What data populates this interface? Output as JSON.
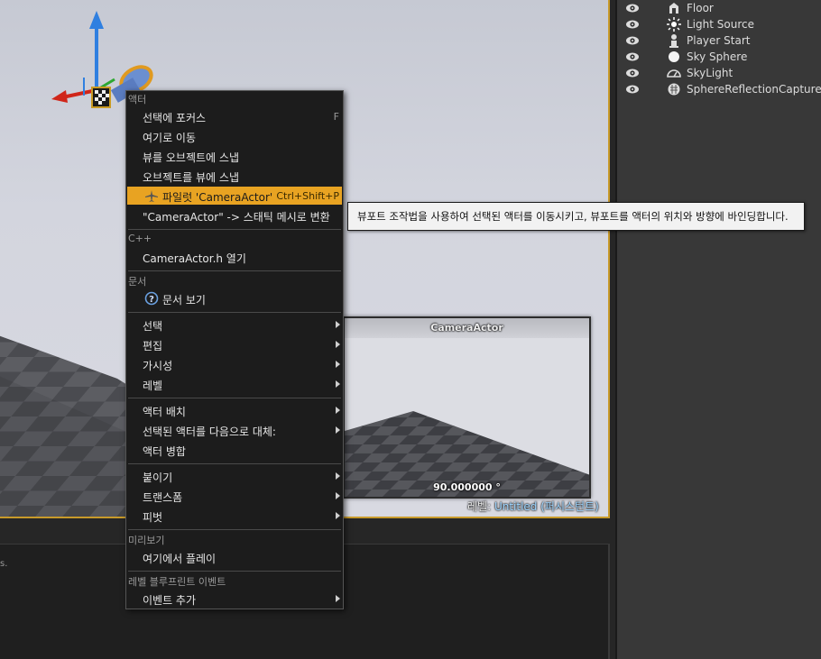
{
  "outliner": {
    "items": [
      {
        "label": "Floor",
        "icon": "floor-icon"
      },
      {
        "label": "Light Source",
        "icon": "light-source-icon"
      },
      {
        "label": "Player Start",
        "icon": "player-start-icon"
      },
      {
        "label": "Sky Sphere",
        "icon": "sky-sphere-icon"
      },
      {
        "label": "SkyLight",
        "icon": "skylight-icon"
      },
      {
        "label": "SphereReflectionCapture",
        "icon": "reflection-capture-icon"
      }
    ]
  },
  "viewport": {
    "preview_title": "CameraActor",
    "preview_angle": "90.000000 °",
    "level_prefix": "레벨: ",
    "level_name": "Untitled (퍼시스턴트)"
  },
  "bottom": {
    "text": "s."
  },
  "menu": {
    "sections": {
      "actor": "액터",
      "cpp": "C++",
      "docs": "문서",
      "preview": "미리보기",
      "level_bp": "레벨 블루프린트 이벤트"
    },
    "items": {
      "focus": "선택에 포커스",
      "focus_shortcut": "F",
      "move_here": "여기로 이동",
      "snap_view_to_object": "뷰를 오브젝트에 스냅",
      "snap_object_to_view": "오브젝트를 뷰에 스냅",
      "pilot": "파일럿 'CameraActor'",
      "pilot_shortcut": "Ctrl+Shift+P",
      "convert": "\"CameraActor\" -> 스태틱 메시로 변환",
      "open_header": "CameraActor.h 열기",
      "view_docs": "문서 보기",
      "select": "선택",
      "edit": "편집",
      "visibility": "가시성",
      "level": "레벨",
      "place_actor": "액터 배치",
      "replace_actor": "선택된 액터를 다음으로 대체:",
      "merge_actors": "액터 병합",
      "attach": "붙이기",
      "transform": "트랜스폼",
      "pivot": "피벗",
      "play_here": "여기에서 플레이",
      "add_event": "이벤트 추가"
    }
  },
  "tooltip": {
    "text": "뷰포트 조작법을 사용하여 선택된 액터를 이동시키고, 뷰포트를 액터의 위치와 방향에 바인딩합니다."
  },
  "colors": {
    "highlight": "#e8a322",
    "selection_frame": "#c89a2a",
    "gizmo_z": "#2f7fe0",
    "gizmo_x": "#d0261a"
  }
}
